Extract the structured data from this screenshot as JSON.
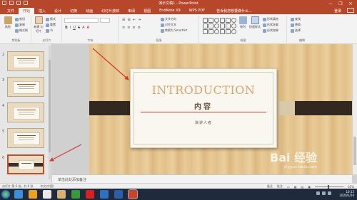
{
  "window": {
    "title": "演示文稿1 - PowerPoint",
    "minimize": "—",
    "restore": "❐",
    "close": "✕"
  },
  "ribbon_tabs": [
    "文件",
    "开始",
    "插入",
    "设计",
    "切换",
    "动画",
    "幻灯片放映",
    "审阅",
    "视图",
    "EndNote X9",
    "WPS PDF"
  ],
  "active_tab_index": 1,
  "tell_me": "告诉我您想要做什么...",
  "login": "登录",
  "ribbon": {
    "paste": "粘贴",
    "cut": "剪切",
    "copy": "复制",
    "format_painter": "格式刷",
    "clipboard_group": "剪贴板",
    "new_slide": "新建\n幻灯片",
    "layout": "版式",
    "reset": "重置",
    "section": "节",
    "slides_group": "幻灯片",
    "font_size": "",
    "font_group": "字体",
    "text_direction": "文字方向",
    "align_text": "对齐文本",
    "smartart": "转换为 SmartArt",
    "paragraph_group": "段落",
    "drawing_group": "绘图",
    "arrange": "排列",
    "quick_styles": "快速样式",
    "shape_fill": "形状填充",
    "shape_outline": "形状轮廓",
    "shape_effects": "形状效果",
    "find": "查找",
    "replace": "替换",
    "select": "选择",
    "editing_group": "编辑",
    "bold": "B",
    "italic": "I",
    "underline": "U",
    "strike": "S",
    "case": "A"
  },
  "thumbnails": [
    {
      "number": "2"
    },
    {
      "number": "3"
    },
    {
      "number": "4"
    },
    {
      "number": "5"
    },
    {
      "number": "6"
    }
  ],
  "slide": {
    "title": "INTRODUCTION",
    "subtitle": "内容",
    "author": "演讲人者"
  },
  "notes_placeholder": "单击此处添加备注",
  "status": {
    "slide_info": "幻灯片 第 6 张，共 6 张",
    "language": "中文(中国)",
    "notes": "备注",
    "comments": "批注",
    "zoom": "62%"
  },
  "taskbar": {
    "time": "10:15",
    "date": "2020/1/20"
  },
  "watermark": {
    "brand": "Bai 经验",
    "url": "jingyan.baidu.com"
  },
  "colors": {
    "accent": "#b7472a",
    "selection": "#c64a2b",
    "title_text": "#d8a670"
  }
}
